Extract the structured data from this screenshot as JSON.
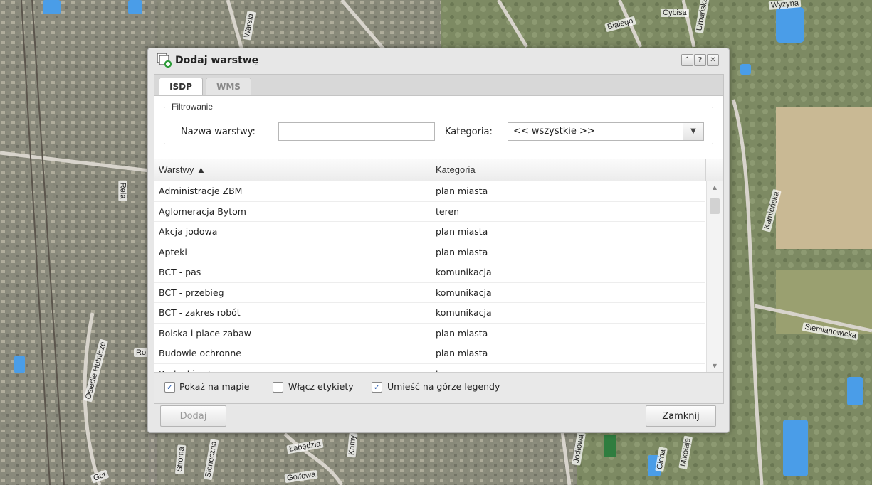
{
  "map": {
    "street_labels": [
      "Cybisa",
      "Białego",
      "Urbańska",
      "Kamieńska",
      "Siemianowicka",
      "Osiedle Hutnicze",
      "Łabędzia",
      "Słoneczna",
      "Jodłowa",
      "Cicha",
      "Mikołaja",
      "Golfowa",
      "Kamy",
      "Rela",
      "Ro",
      "Stroma",
      "Gor",
      "Wyżyna",
      "Warsia"
    ]
  },
  "dialog": {
    "title": "Dodaj warstwę",
    "title_icon": "add-layer-icon",
    "tools": [
      "collapse-icon",
      "help-icon",
      "close-icon"
    ],
    "tabs": [
      {
        "label": "ISDP",
        "active": true
      },
      {
        "label": "WMS",
        "active": false
      }
    ],
    "filter": {
      "legend": "Filtrowanie",
      "name_label": "Nazwa warstwy:",
      "name_value": "",
      "category_label": "Kategoria:",
      "category_value": "<< wszystkie >>"
    },
    "grid": {
      "columns": [
        "Warstwy ▲",
        "Kategoria"
      ],
      "rows": [
        {
          "name": "Administracje ZBM",
          "category": "plan miasta"
        },
        {
          "name": "Aglomeracja Bytom",
          "category": "teren"
        },
        {
          "name": "Akcja jodowa",
          "category": "plan miasta"
        },
        {
          "name": "Apteki",
          "category": "plan miasta"
        },
        {
          "name": "BCT - pas",
          "category": "komunikacja"
        },
        {
          "name": "BCT - przebieg",
          "category": "komunikacja"
        },
        {
          "name": "BCT - zakres robót",
          "category": "komunikacja"
        },
        {
          "name": "Boiska i place zabaw",
          "category": "plan miasta"
        },
        {
          "name": "Budowle ochronne",
          "category": "plan miasta"
        },
        {
          "name": "Budynki ustr...",
          "category": "k..."
        }
      ]
    },
    "options": [
      {
        "label": "Pokaż na mapie",
        "checked": true
      },
      {
        "label": "Włącz etykiety",
        "checked": false
      },
      {
        "label": "Umieść na górze legendy",
        "checked": true
      }
    ],
    "buttons": {
      "add": "Dodaj",
      "close": "Zamknij"
    },
    "colors": {
      "accent": "#2a5db0",
      "water": "#4a9de8",
      "disabled_text": "#9a9a9a"
    }
  }
}
